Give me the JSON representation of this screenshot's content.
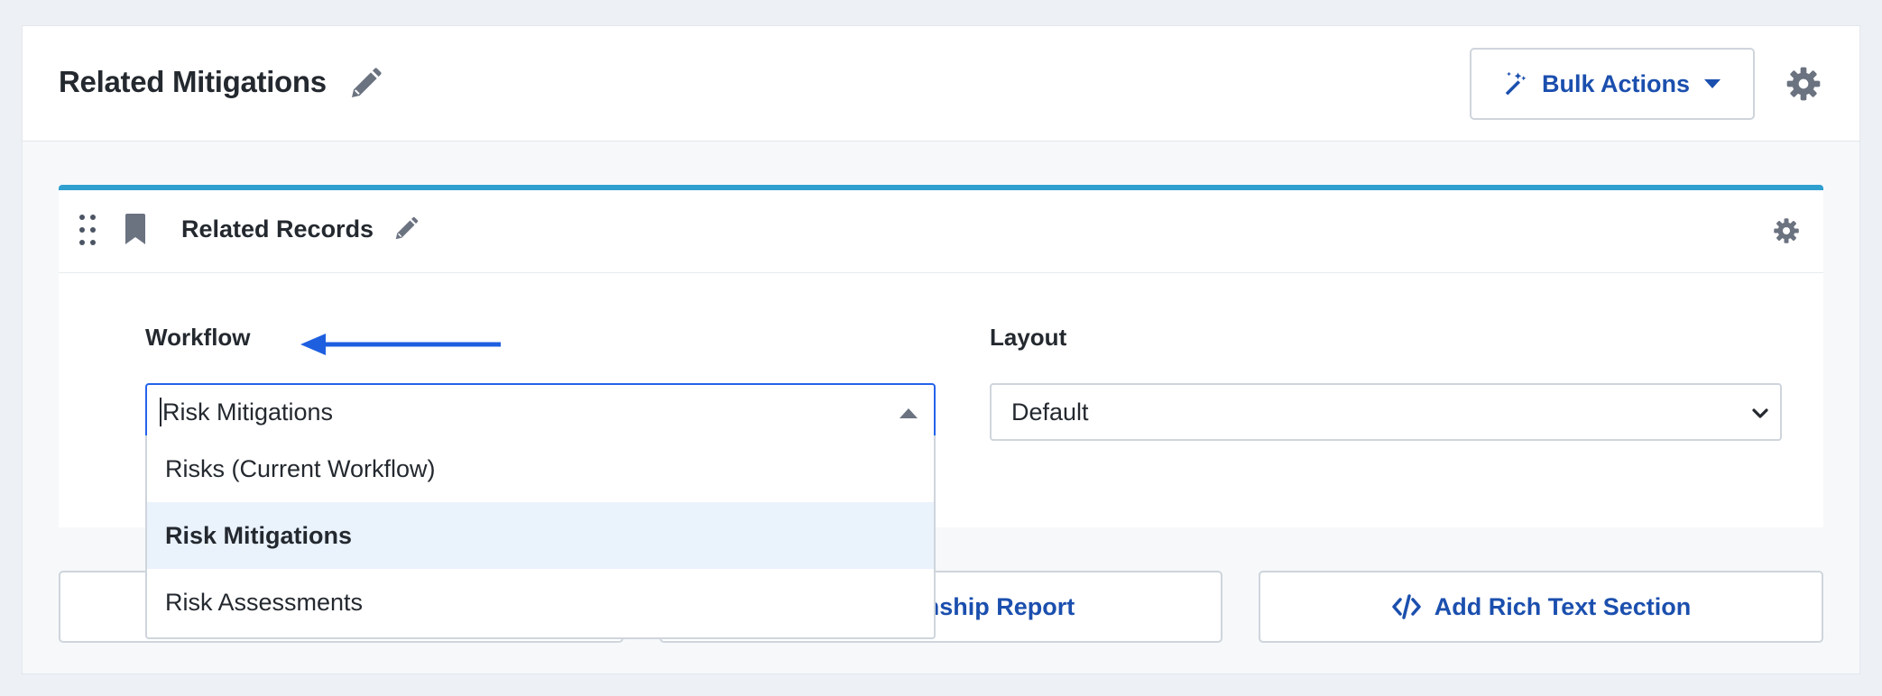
{
  "section": {
    "title": "Related Mitigations",
    "bulk_actions_label": "Bulk Actions"
  },
  "card": {
    "title": "Related Records"
  },
  "workflow": {
    "label": "Workflow",
    "value": "Risk Mitigations",
    "options": [
      {
        "label": "Risks (Current Workflow)",
        "selected": false
      },
      {
        "label": "Risk Mitigations",
        "selected": true
      },
      {
        "label": "Risk Assessments",
        "selected": false
      }
    ]
  },
  "layout": {
    "label": "Layout",
    "value": "Default"
  },
  "actions": {
    "relationship_report_label": "ationship Report",
    "rich_text_label": "Add Rich Text Section"
  },
  "colors": {
    "accent": "#1b4fae",
    "card_top_border": "#2f9fcf",
    "focus_border": "#2563eb",
    "arrow": "#1e5fe0",
    "selected_option_bg": "#eaf2fc",
    "icon_gray": "#6b7280"
  }
}
